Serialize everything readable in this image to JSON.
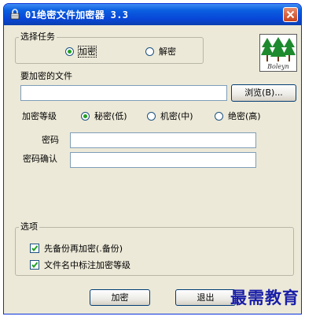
{
  "window": {
    "title": "01绝密文件加密器 3.3"
  },
  "task_group": {
    "legend": "选择任务",
    "options": [
      {
        "label": "加密",
        "selected": true
      },
      {
        "label": "解密",
        "selected": false
      }
    ]
  },
  "file": {
    "label": "要加密的文件",
    "value": "",
    "browse_label": "浏览(B)..."
  },
  "level": {
    "label": "加密等级",
    "options": [
      {
        "label": "秘密(低)",
        "selected": true
      },
      {
        "label": "机密(中)",
        "selected": false
      },
      {
        "label": "绝密(高)",
        "selected": false
      }
    ]
  },
  "password": {
    "label": "密码",
    "value": ""
  },
  "confirm": {
    "label": "密码确认",
    "value": ""
  },
  "options_group": {
    "legend": "选项",
    "items": [
      {
        "label": "先备份再加密(.备份)",
        "checked": true
      },
      {
        "label": "文件名中标注加密等级",
        "checked": true
      }
    ]
  },
  "buttons": {
    "encrypt": "加密",
    "exit": "退出"
  },
  "logo": {
    "text": "Boleyn"
  },
  "watermark": {
    "text": "最需教育"
  },
  "colors": {
    "titlebar": "#0846d8",
    "face": "#ece9d8",
    "radio_dot": "#21a121",
    "check": "#21a121",
    "watermark": "#1a1fa8"
  }
}
